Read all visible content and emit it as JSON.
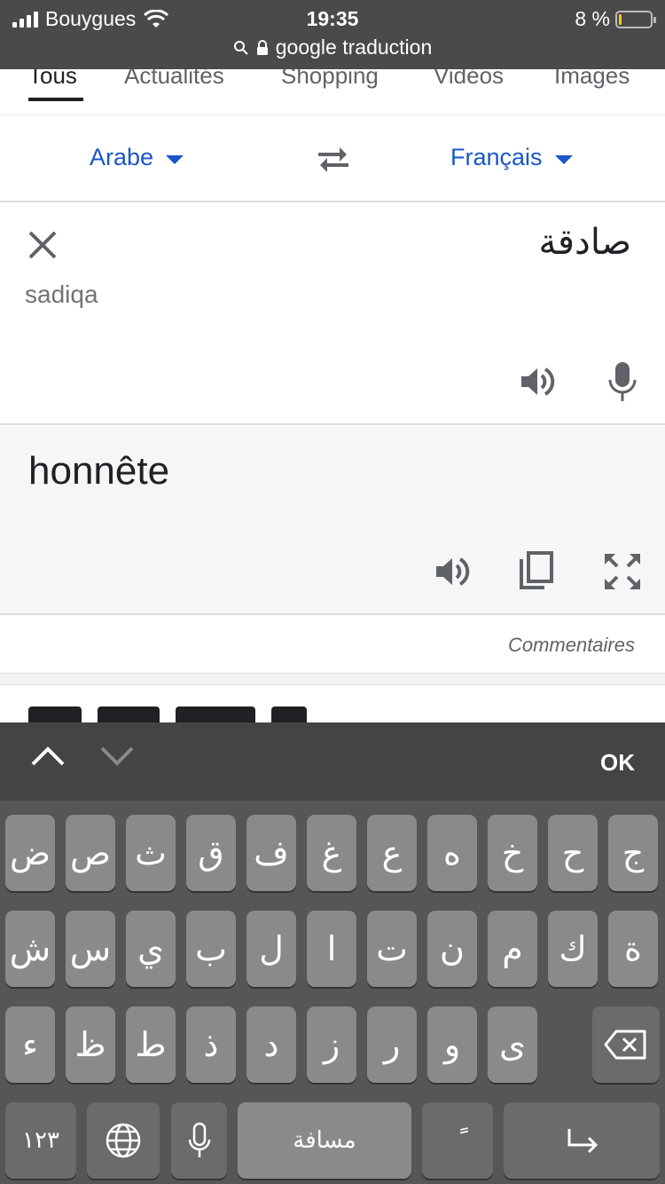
{
  "status": {
    "carrier": "Bouygues",
    "time": "19:35",
    "battery": "8 %",
    "battery_level": 0.08,
    "url": "google traduction"
  },
  "tabs": [
    "Tous",
    "Actualités",
    "Shopping",
    "Vidéos",
    "Images"
  ],
  "languages": {
    "source": "Arabe",
    "target": "Français"
  },
  "source": {
    "text": "صادقة",
    "transliteration": "sadiqa"
  },
  "translation": {
    "text": "honnête"
  },
  "feedback_label": "Commentaires",
  "accessory": {
    "done_label": "OK"
  },
  "keyboard": {
    "row1": [
      "ض",
      "ص",
      "ث",
      "ق",
      "ف",
      "غ",
      "ع",
      "ه",
      "خ",
      "ح",
      "ج"
    ],
    "row2": [
      "ش",
      "س",
      "ي",
      "ب",
      "ل",
      "ا",
      "ت",
      "ن",
      "م",
      "ك",
      "ة"
    ],
    "row3": [
      "ء",
      "ظ",
      "ط",
      "ذ",
      "د",
      "ز",
      "ر",
      "و",
      "ى"
    ],
    "numbers_label": "١٢٣",
    "space_label": "مسافة",
    "diacritic_label": "ًَ"
  }
}
